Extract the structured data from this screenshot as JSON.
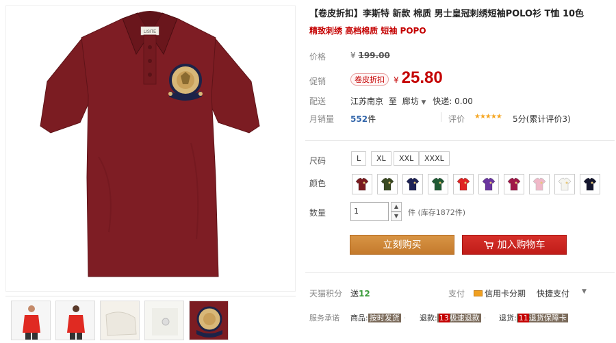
{
  "product": {
    "title": "【卷皮折扣】李斯特 新款 棉质 男士皇冠刺绣短袖POLO衫 T恤 10色",
    "subtitle": "精致刺绣 高档棉质 短袖 POPO",
    "collar_label": "LISITE"
  },
  "price": {
    "orig_label": "价格",
    "orig_currency": "¥",
    "orig_value": "199.00",
    "promo_label": "促销",
    "promo_tag": "卷皮折扣",
    "promo_currency": "¥",
    "promo_value": "25.80"
  },
  "shipping": {
    "label": "配送",
    "from": "江苏南京",
    "to_word": "至",
    "dest": "廊坊",
    "fee": "快递: 0.00"
  },
  "sales": {
    "label": "月销量",
    "count": "552",
    "unit": "件",
    "review_label": "评价",
    "stars": "★★★★★",
    "review_text": "5分(累计评价3)"
  },
  "size": {
    "label": "尺码",
    "options": [
      "L",
      "XL",
      "XXL",
      "XXXL"
    ]
  },
  "color": {
    "label": "颜色",
    "swatches": [
      "#7a1a1f",
      "#3a4a22",
      "#1e2255",
      "#1f5a34",
      "#e02424",
      "#6a35a0",
      "#a01848",
      "#f0b8c8",
      "#f4f4ee",
      "#14162e"
    ]
  },
  "quantity": {
    "label": "数量",
    "value": "1",
    "note": "件 (库存1872件)"
  },
  "actions": {
    "buy": "立刻购买",
    "cart": "加入购物车"
  },
  "points": {
    "label": "天猫积分",
    "text": "送",
    "value": "12"
  },
  "payment": {
    "label": "支付",
    "credit": "信用卡分期",
    "quick": "快捷支付"
  },
  "service": {
    "label": "服务承诺",
    "items": [
      {
        "prefix": "商品:",
        "tag_a": "按时发货",
        "tag_b": ""
      },
      {
        "prefix": "退款:",
        "tag_a": "13",
        "tag_b": "极速退款"
      },
      {
        "prefix": "退货:",
        "tag_a": "11",
        "tag_b": "退货保障卡"
      }
    ]
  },
  "colors": {
    "shirt": "#7b1c22",
    "accent_red": "#c40000",
    "buy_btn": "#cc8833",
    "cart_btn": "#c8221e"
  }
}
